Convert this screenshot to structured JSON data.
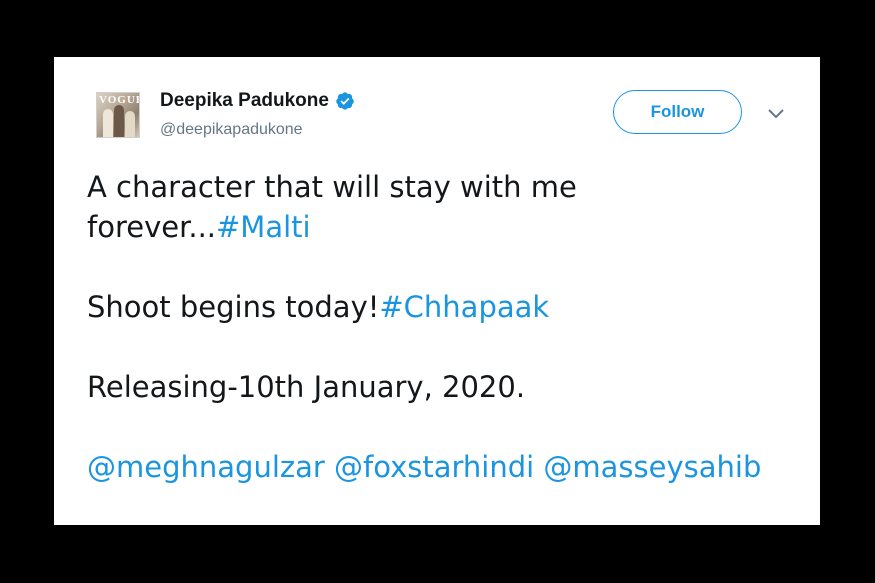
{
  "tweet": {
    "author": {
      "display_name": "Deepika Padukone",
      "handle": "@deepikapadukone",
      "verified": true,
      "avatar_masthead": "VOGUE"
    },
    "follow_label": "Follow",
    "body": {
      "line1_text": "A character that will stay with me forever...",
      "hashtag_malti": "#Malti",
      "line2_text": "Shoot begins today!",
      "hashtag_chhapaak": "#Chhapaak",
      "line3_text": "Releasing-10th January, 2020.",
      "mention_meghnagulzar": "@meghnagulzar",
      "mention_foxstarhindi": "@foxstarhindi",
      "mention_masseysahib": "@masseysahib"
    }
  },
  "colors": {
    "link": "#1b95e0",
    "text": "#14171a",
    "secondary": "#657786",
    "background": "#000000",
    "card": "#ffffff"
  },
  "icons": [
    "verified-badge-icon",
    "chevron-down-icon"
  ]
}
